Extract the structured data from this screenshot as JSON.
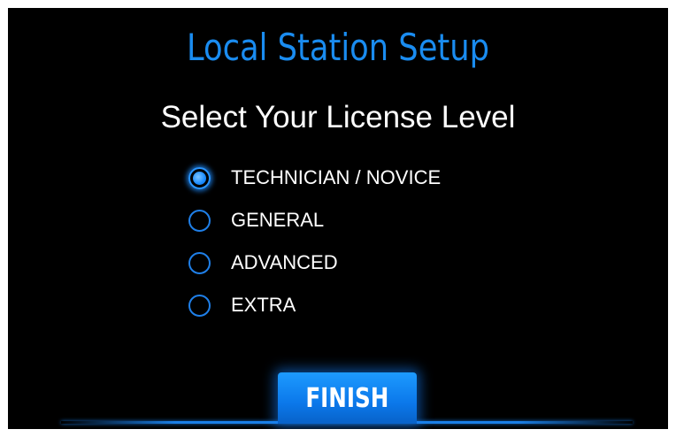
{
  "header": {
    "title": "Local Station Setup",
    "subtitle": "Select Your License Level"
  },
  "license_options": [
    {
      "label": "TECHNICIAN / NOVICE",
      "selected": true
    },
    {
      "label": "GENERAL",
      "selected": false
    },
    {
      "label": "ADVANCED",
      "selected": false
    },
    {
      "label": "EXTRA",
      "selected": false
    }
  ],
  "footer": {
    "finish_label": "FINISH"
  },
  "colors": {
    "background": "#000000",
    "accent": "#1a8cf0",
    "text": "#ffffff"
  }
}
